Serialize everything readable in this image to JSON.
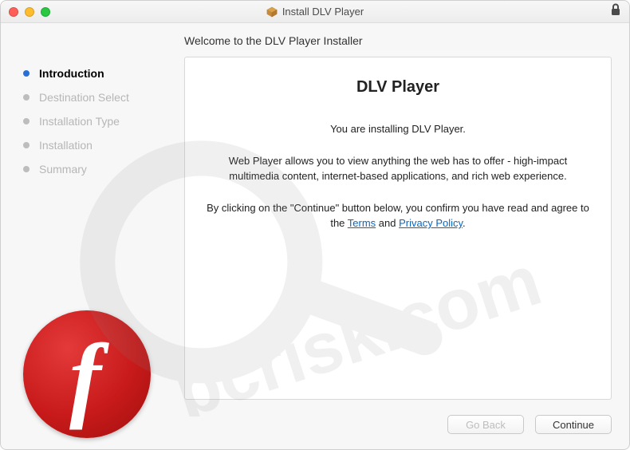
{
  "window": {
    "title": "Install DLV Player"
  },
  "header": {
    "welcome": "Welcome to the DLV Player Installer"
  },
  "sidebar": {
    "steps": [
      {
        "label": "Introduction",
        "active": true
      },
      {
        "label": "Destination Select",
        "active": false
      },
      {
        "label": "Installation Type",
        "active": false
      },
      {
        "label": "Installation",
        "active": false
      },
      {
        "label": "Summary",
        "active": false
      }
    ]
  },
  "panel": {
    "title": "DLV Player",
    "line1": "You are installing DLV Player.",
    "line2": "Web Player allows you to view anything the web has to offer - high-impact multimedia content, internet-based applications, and rich web experience.",
    "consent_prefix": "By clicking on the \"Continue\" button below, you confirm you have read and agree to the ",
    "terms_label": "Terms",
    "consent_and": " and ",
    "privacy_label": "Privacy Policy",
    "consent_suffix": "."
  },
  "footer": {
    "go_back": "Go Back",
    "continue": "Continue"
  },
  "watermark": {
    "text": "pcrisk.com"
  }
}
